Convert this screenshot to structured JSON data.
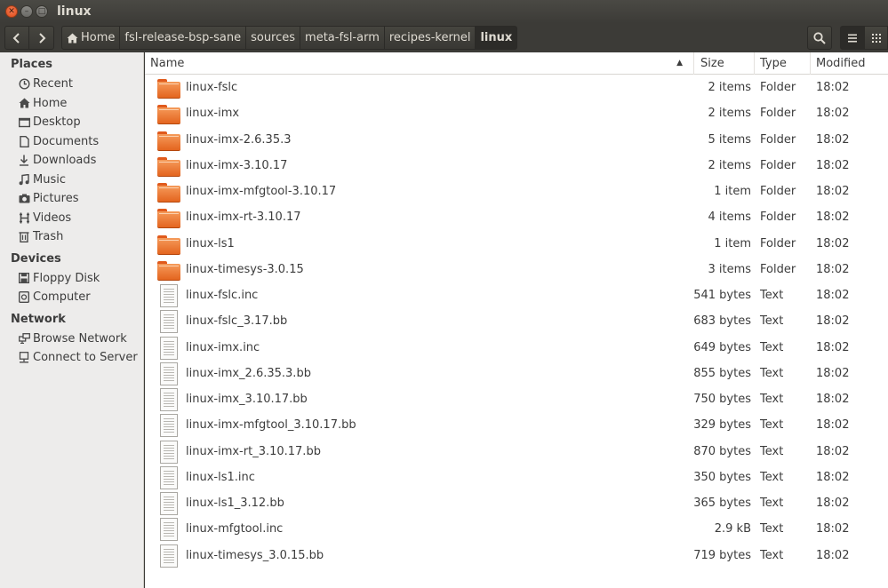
{
  "window": {
    "title": "linux"
  },
  "breadcrumbs": [
    "Home",
    "fsl-release-bsp-sane",
    "sources",
    "meta-fsl-arm",
    "recipes-kernel",
    "linux"
  ],
  "sidebar": {
    "places_title": "Places",
    "places": [
      {
        "label": "Recent",
        "icon": "clock-icon"
      },
      {
        "label": "Home",
        "icon": "home-icon"
      },
      {
        "label": "Desktop",
        "icon": "desktop-icon"
      },
      {
        "label": "Documents",
        "icon": "document-icon"
      },
      {
        "label": "Downloads",
        "icon": "download-icon"
      },
      {
        "label": "Music",
        "icon": "music-icon"
      },
      {
        "label": "Pictures",
        "icon": "camera-icon"
      },
      {
        "label": "Videos",
        "icon": "film-icon"
      },
      {
        "label": "Trash",
        "icon": "trash-icon"
      }
    ],
    "devices_title": "Devices",
    "devices": [
      {
        "label": "Floppy Disk",
        "icon": "floppy-icon"
      },
      {
        "label": "Computer",
        "icon": "computer-icon"
      }
    ],
    "network_title": "Network",
    "network": [
      {
        "label": "Browse Network",
        "icon": "network-icon"
      },
      {
        "label": "Connect to Server",
        "icon": "server-icon"
      }
    ]
  },
  "columns": {
    "name": "Name",
    "size": "Size",
    "type": "Type",
    "modified": "Modified"
  },
  "files": [
    {
      "name": "linux-fslc",
      "size": "2 items",
      "type": "Folder",
      "modified": "18:02",
      "kind": "folder"
    },
    {
      "name": "linux-imx",
      "size": "2 items",
      "type": "Folder",
      "modified": "18:02",
      "kind": "folder"
    },
    {
      "name": "linux-imx-2.6.35.3",
      "size": "5 items",
      "type": "Folder",
      "modified": "18:02",
      "kind": "folder"
    },
    {
      "name": "linux-imx-3.10.17",
      "size": "2 items",
      "type": "Folder",
      "modified": "18:02",
      "kind": "folder"
    },
    {
      "name": "linux-imx-mfgtool-3.10.17",
      "size": "1 item",
      "type": "Folder",
      "modified": "18:02",
      "kind": "folder"
    },
    {
      "name": "linux-imx-rt-3.10.17",
      "size": "4 items",
      "type": "Folder",
      "modified": "18:02",
      "kind": "folder"
    },
    {
      "name": "linux-ls1",
      "size": "1 item",
      "type": "Folder",
      "modified": "18:02",
      "kind": "folder"
    },
    {
      "name": "linux-timesys-3.0.15",
      "size": "3 items",
      "type": "Folder",
      "modified": "18:02",
      "kind": "folder"
    },
    {
      "name": "linux-fslc.inc",
      "size": "541 bytes",
      "type": "Text",
      "modified": "18:02",
      "kind": "text"
    },
    {
      "name": "linux-fslc_3.17.bb",
      "size": "683 bytes",
      "type": "Text",
      "modified": "18:02",
      "kind": "text"
    },
    {
      "name": "linux-imx.inc",
      "size": "649 bytes",
      "type": "Text",
      "modified": "18:02",
      "kind": "text"
    },
    {
      "name": "linux-imx_2.6.35.3.bb",
      "size": "855 bytes",
      "type": "Text",
      "modified": "18:02",
      "kind": "text"
    },
    {
      "name": "linux-imx_3.10.17.bb",
      "size": "750 bytes",
      "type": "Text",
      "modified": "18:02",
      "kind": "text"
    },
    {
      "name": "linux-imx-mfgtool_3.10.17.bb",
      "size": "329 bytes",
      "type": "Text",
      "modified": "18:02",
      "kind": "text"
    },
    {
      "name": "linux-imx-rt_3.10.17.bb",
      "size": "870 bytes",
      "type": "Text",
      "modified": "18:02",
      "kind": "text"
    },
    {
      "name": "linux-ls1.inc",
      "size": "350 bytes",
      "type": "Text",
      "modified": "18:02",
      "kind": "text"
    },
    {
      "name": "linux-ls1_3.12.bb",
      "size": "365 bytes",
      "type": "Text",
      "modified": "18:02",
      "kind": "text"
    },
    {
      "name": "linux-mfgtool.inc",
      "size": "2.9 kB",
      "type": "Text",
      "modified": "18:02",
      "kind": "text"
    },
    {
      "name": "linux-timesys_3.0.15.bb",
      "size": "719 bytes",
      "type": "Text",
      "modified": "18:02",
      "kind": "text"
    }
  ],
  "colors": {
    "accent": "#e4651f",
    "titlebar": "#3c3b37",
    "sidebar": "#edeceb"
  }
}
